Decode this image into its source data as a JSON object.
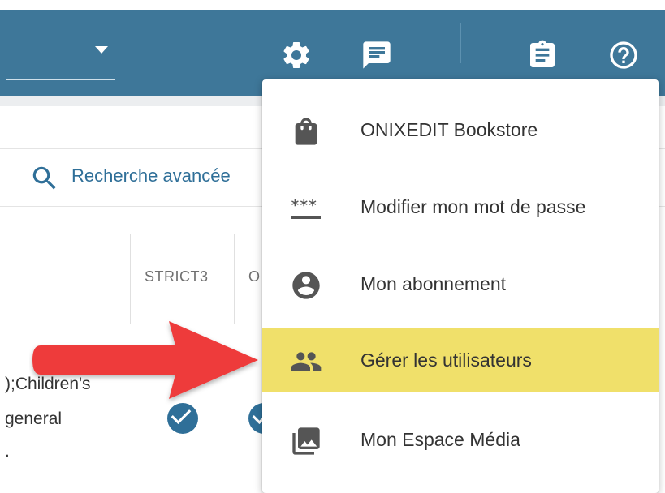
{
  "topbar": {
    "icons": [
      "gear-icon",
      "message-icon",
      "clipboard-icon",
      "help-icon"
    ]
  },
  "search": {
    "label": "Recherche avancée"
  },
  "table": {
    "columns": [
      "STRICT3",
      "O"
    ],
    "row": {
      "line1": ");Children's",
      "line2": "general",
      "line3": "."
    }
  },
  "menu": {
    "items": [
      {
        "icon": "shopping-bag-icon",
        "label": "ONIXEDIT Bookstore"
      },
      {
        "icon": "password-icon",
        "label": "Modifier mon mot de passe"
      },
      {
        "icon": "account-circle-icon",
        "label": "Mon abonnement"
      },
      {
        "icon": "people-icon",
        "label": "Gérer les utilisateurs"
      },
      {
        "icon": "photo-library-icon",
        "label": "Mon Espace Média"
      }
    ],
    "highlight_color": "#f0e06a"
  },
  "colors": {
    "topbar": "#3e7799",
    "accent": "#2f6f98",
    "arrow": "#ee3b3b"
  }
}
